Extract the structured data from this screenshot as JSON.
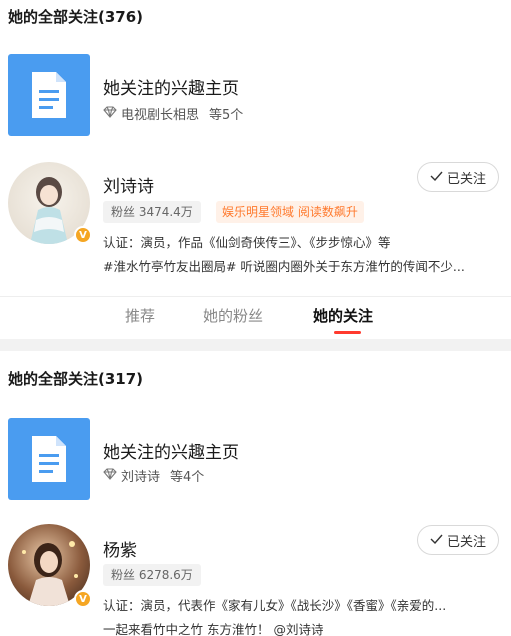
{
  "block1": {
    "header": "她的全部关注(376)",
    "interest": {
      "title": "她关注的兴趣主页",
      "sub_name": "电视剧长相思",
      "sub_more": "等5个"
    },
    "user": {
      "name": "刘诗诗",
      "fans": "粉丝 3474.4万",
      "hot_tag": "娱乐明星领域 阅读数飙升",
      "verify": "认证：演员，作品《仙剑奇侠传三》、《步步惊心》等",
      "post": "#淮水竹亭竹友出圈局# 听说圈内圈外关于东方淮竹的传闻不少...",
      "follow_label": "已关注"
    }
  },
  "tabs": [
    "推荐",
    "她的粉丝",
    "她的关注"
  ],
  "block2": {
    "header": "她的全部关注(317)",
    "interest": {
      "title": "她关注的兴趣主页",
      "sub_name": "刘诗诗",
      "sub_more": "等4个"
    },
    "user": {
      "name": "杨紫",
      "fans": "粉丝 6278.6万",
      "verify": "认证：演员，代表作《家有儿女》《战长沙》《香蜜》《亲爱的...",
      "post": "一起来看竹中之竹 东方淮竹！ @刘诗诗",
      "follow_label": "已关注"
    }
  },
  "colors": {
    "accent": "#ff3a2e",
    "doc_tile": "#4a9cf0",
    "hot_tag": "#ff7a2e",
    "v_badge": "#f5a623"
  },
  "icons": [
    "document-icon",
    "gem-icon",
    "check-icon",
    "v-badge-icon"
  ]
}
